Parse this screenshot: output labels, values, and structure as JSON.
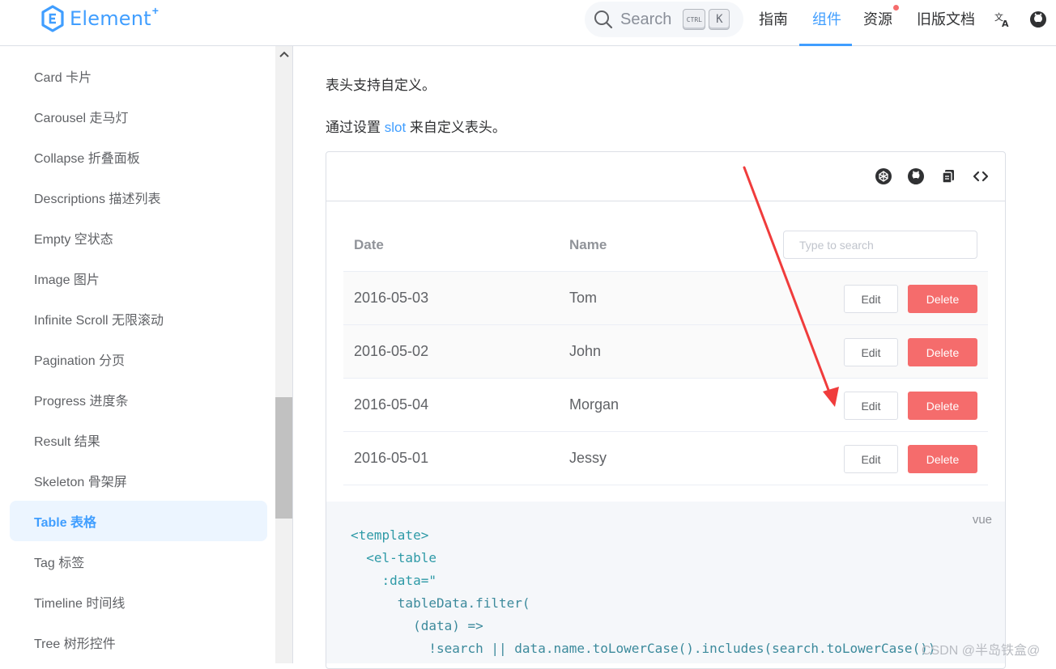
{
  "header": {
    "logo_text": "Element",
    "logo_plus": "+",
    "search_label": "Search",
    "kbd_ctrl": "CTRL",
    "kbd_k": "K",
    "nav": [
      "指南",
      "组件",
      "资源",
      "旧版文档"
    ],
    "active_nav": "组件",
    "brand_color": "#409eff"
  },
  "sidebar": {
    "items": [
      {
        "label": "Card 卡片"
      },
      {
        "label": "Carousel 走马灯"
      },
      {
        "label": "Collapse 折叠面板"
      },
      {
        "label": "Descriptions 描述列表"
      },
      {
        "label": "Empty 空状态"
      },
      {
        "label": "Image 图片"
      },
      {
        "label": "Infinite Scroll 无限滚动"
      },
      {
        "label": "Pagination 分页"
      },
      {
        "label": "Progress 进度条"
      },
      {
        "label": "Result 结果"
      },
      {
        "label": "Skeleton 骨架屏"
      },
      {
        "label": "Table 表格"
      },
      {
        "label": "Tag 标签"
      },
      {
        "label": "Timeline 时间线"
      },
      {
        "label": "Tree 树形控件"
      }
    ],
    "active_item": "Table 表格"
  },
  "main": {
    "heading": "表头支持自定义。",
    "desc_before": "通过设置 ",
    "desc_link": "slot",
    "desc_after": " 来自定义表头。",
    "toolbar_icons": [
      "codepen-icon",
      "github-icon",
      "copy-icon",
      "code-icon"
    ],
    "table": {
      "columns": [
        "Date",
        "Name"
      ],
      "search_placeholder": "Type to search",
      "rows": [
        {
          "date": "2016-05-03",
          "name": "Tom",
          "edit": "Edit",
          "delete": "Delete"
        },
        {
          "date": "2016-05-02",
          "name": "John",
          "edit": "Edit",
          "delete": "Delete"
        },
        {
          "date": "2016-05-04",
          "name": "Morgan",
          "edit": "Edit",
          "delete": "Delete"
        },
        {
          "date": "2016-05-01",
          "name": "Jessy",
          "edit": "Edit",
          "delete": "Delete"
        }
      ]
    },
    "code": {
      "lang": "vue",
      "lines": [
        "<template>",
        "  <el-table",
        "    :data=\"",
        "      tableData.filter(",
        "        (data) =>",
        "          !search || data.name.toLowerCase().includes(search.toLowerCase())"
      ]
    },
    "watermark": "CSDN @半岛铁盒@"
  },
  "colors": {
    "danger": "#f56c6c",
    "annotation_arrow": "#f03c3c"
  }
}
